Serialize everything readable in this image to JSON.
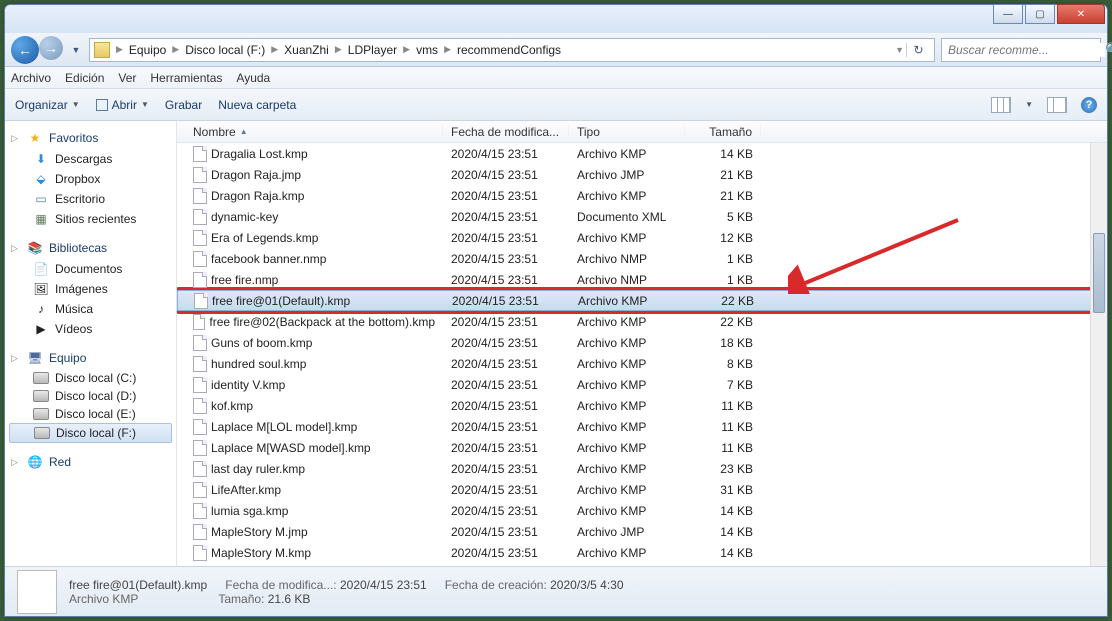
{
  "titlebar": {
    "min": "—",
    "max": "▢",
    "close": "✕"
  },
  "breadcrumb": {
    "items": [
      "Equipo",
      "Disco local (F:)",
      "XuanZhi",
      "LDPlayer",
      "vms",
      "recommendConfigs"
    ],
    "refresh": "↻"
  },
  "search": {
    "placeholder": "Buscar recomme..."
  },
  "menubar": [
    "Archivo",
    "Edición",
    "Ver",
    "Herramientas",
    "Ayuda"
  ],
  "toolbar": {
    "organize": "Organizar",
    "open": "Abrir",
    "burn": "Grabar",
    "newfolder": "Nueva carpeta"
  },
  "sidebar": {
    "fav": {
      "hdr": "Favoritos",
      "items": [
        "Descargas",
        "Dropbox",
        "Escritorio",
        "Sitios recientes"
      ]
    },
    "lib": {
      "hdr": "Bibliotecas",
      "items": [
        "Documentos",
        "Imágenes",
        "Música",
        "Vídeos"
      ]
    },
    "pc": {
      "hdr": "Equipo",
      "items": [
        "Disco local (C:)",
        "Disco local (D:)",
        "Disco local (E:)",
        "Disco local (F:)"
      ],
      "sel": 3
    },
    "net": {
      "hdr": "Red"
    }
  },
  "columns": {
    "name": "Nombre",
    "date": "Fecha de modifica...",
    "type": "Tipo",
    "size": "Tamaño"
  },
  "files": [
    {
      "n": "Dragalia Lost.kmp",
      "d": "2020/4/15 23:51",
      "t": "Archivo KMP",
      "s": "14 KB"
    },
    {
      "n": "Dragon Raja.jmp",
      "d": "2020/4/15 23:51",
      "t": "Archivo JMP",
      "s": "21 KB"
    },
    {
      "n": "Dragon Raja.kmp",
      "d": "2020/4/15 23:51",
      "t": "Archivo KMP",
      "s": "21 KB"
    },
    {
      "n": "dynamic-key",
      "d": "2020/4/15 23:51",
      "t": "Documento XML",
      "s": "5 KB"
    },
    {
      "n": "Era of Legends.kmp",
      "d": "2020/4/15 23:51",
      "t": "Archivo KMP",
      "s": "12 KB"
    },
    {
      "n": "facebook banner.nmp",
      "d": "2020/4/15 23:51",
      "t": "Archivo NMP",
      "s": "1 KB"
    },
    {
      "n": "free fire.nmp",
      "d": "2020/4/15 23:51",
      "t": "Archivo NMP",
      "s": "1 KB"
    },
    {
      "n": "free fire@01(Default).kmp",
      "d": "2020/4/15 23:51",
      "t": "Archivo KMP",
      "s": "22 KB",
      "sel": true,
      "hl": true
    },
    {
      "n": "free fire@02(Backpack at the bottom).kmp",
      "d": "2020/4/15 23:51",
      "t": "Archivo KMP",
      "s": "22 KB"
    },
    {
      "n": "Guns of boom.kmp",
      "d": "2020/4/15 23:51",
      "t": "Archivo KMP",
      "s": "18 KB"
    },
    {
      "n": "hundred soul.kmp",
      "d": "2020/4/15 23:51",
      "t": "Archivo KMP",
      "s": "8 KB"
    },
    {
      "n": "identity V.kmp",
      "d": "2020/4/15 23:51",
      "t": "Archivo KMP",
      "s": "7 KB"
    },
    {
      "n": "kof.kmp",
      "d": "2020/4/15 23:51",
      "t": "Archivo KMP",
      "s": "11 KB"
    },
    {
      "n": "Laplace M[LOL model].kmp",
      "d": "2020/4/15 23:51",
      "t": "Archivo KMP",
      "s": "11 KB"
    },
    {
      "n": "Laplace M[WASD model].kmp",
      "d": "2020/4/15 23:51",
      "t": "Archivo KMP",
      "s": "11 KB"
    },
    {
      "n": "last day ruler.kmp",
      "d": "2020/4/15 23:51",
      "t": "Archivo KMP",
      "s": "23 KB"
    },
    {
      "n": "LifeAfter.kmp",
      "d": "2020/4/15 23:51",
      "t": "Archivo KMP",
      "s": "31 KB"
    },
    {
      "n": "lumia sga.kmp",
      "d": "2020/4/15 23:51",
      "t": "Archivo KMP",
      "s": "14 KB"
    },
    {
      "n": "MapleStory M.jmp",
      "d": "2020/4/15 23:51",
      "t": "Archivo JMP",
      "s": "14 KB"
    },
    {
      "n": "MapleStory M.kmp",
      "d": "2020/4/15 23:51",
      "t": "Archivo KMP",
      "s": "14 KB"
    }
  ],
  "status": {
    "name": "free fire@01(Default).kmp",
    "type": "Archivo KMP",
    "mod_lbl": "Fecha de modifica...:",
    "mod_val": "2020/4/15 23:51",
    "size_lbl": "Tamaño:",
    "size_val": "21.6 KB",
    "created_lbl": "Fecha de creación:",
    "created_val": "2020/3/5 4:30"
  }
}
